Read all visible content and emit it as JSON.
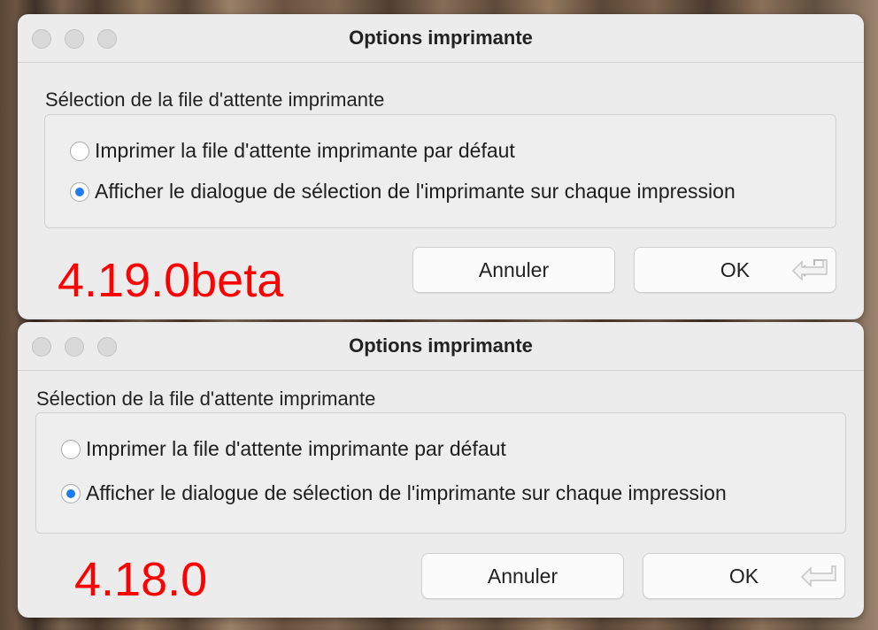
{
  "dialogs": [
    {
      "title": "Options imprimante",
      "section_label": "Sélection de la file d'attente imprimante",
      "options": [
        {
          "label": "Imprimer la file d'attente imprimante par défaut",
          "selected": false
        },
        {
          "label": "Afficher le dialogue de sélection de l'imprimante sur chaque impression",
          "selected": true
        }
      ],
      "cancel_label": "Annuler",
      "ok_label": "OK",
      "version_annotation": "4.19.0beta"
    },
    {
      "title": "Options imprimante",
      "section_label": "Sélection de la file d'attente imprimante",
      "options": [
        {
          "label": "Imprimer la file d'attente imprimante par défaut",
          "selected": false
        },
        {
          "label": "Afficher le dialogue de sélection de l'imprimante sur chaque impression",
          "selected": true
        }
      ],
      "cancel_label": "Annuler",
      "ok_label": "OK",
      "version_annotation": "4.18.0"
    }
  ],
  "colors": {
    "annotation": "#ff0000",
    "radio_selected": "#1f7cf0"
  },
  "icons": {
    "window_controls": "traffic-light-icons",
    "default_button": "return-key-icon"
  }
}
